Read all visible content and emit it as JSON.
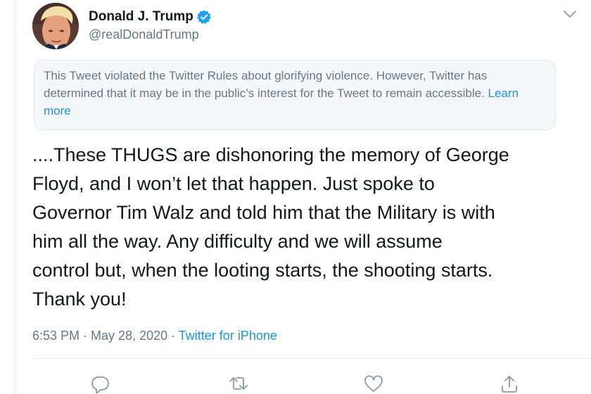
{
  "author": {
    "display_name": "Donald J. Trump",
    "handle": "@realDonaldTrump",
    "verified": true
  },
  "notice": {
    "text": "This Tweet violated the Twitter Rules about glorifying violence. However, Twitter has determined that it may be in the public’s interest for the Tweet to remain accessible. ",
    "link_label": "Learn more"
  },
  "tweet": {
    "lines": [
      "....These THUGS are dishonoring the memory of George",
      "Floyd, and I won’t let that happen. Just spoke to",
      "Governor Tim Walz and told him that the Military is with",
      "him all the way. Any difficulty and we will assume",
      "control but, when the looting starts, the shooting starts.",
      "Thank you!"
    ]
  },
  "meta": {
    "time": "6:53 PM",
    "separator": " · ",
    "date": "May 28, 2020",
    "source": "Twitter for iPhone"
  },
  "icons": {
    "more": "chevron-down-icon",
    "reply": "reply-icon",
    "retweet": "retweet-icon",
    "like": "like-icon",
    "share": "share-icon",
    "verified": "verified-badge-icon"
  },
  "colors": {
    "accent": "#1b95e0",
    "verified": "#1da1f2",
    "secondary_text": "#657786",
    "notice_bg": "#f5f8fa"
  }
}
